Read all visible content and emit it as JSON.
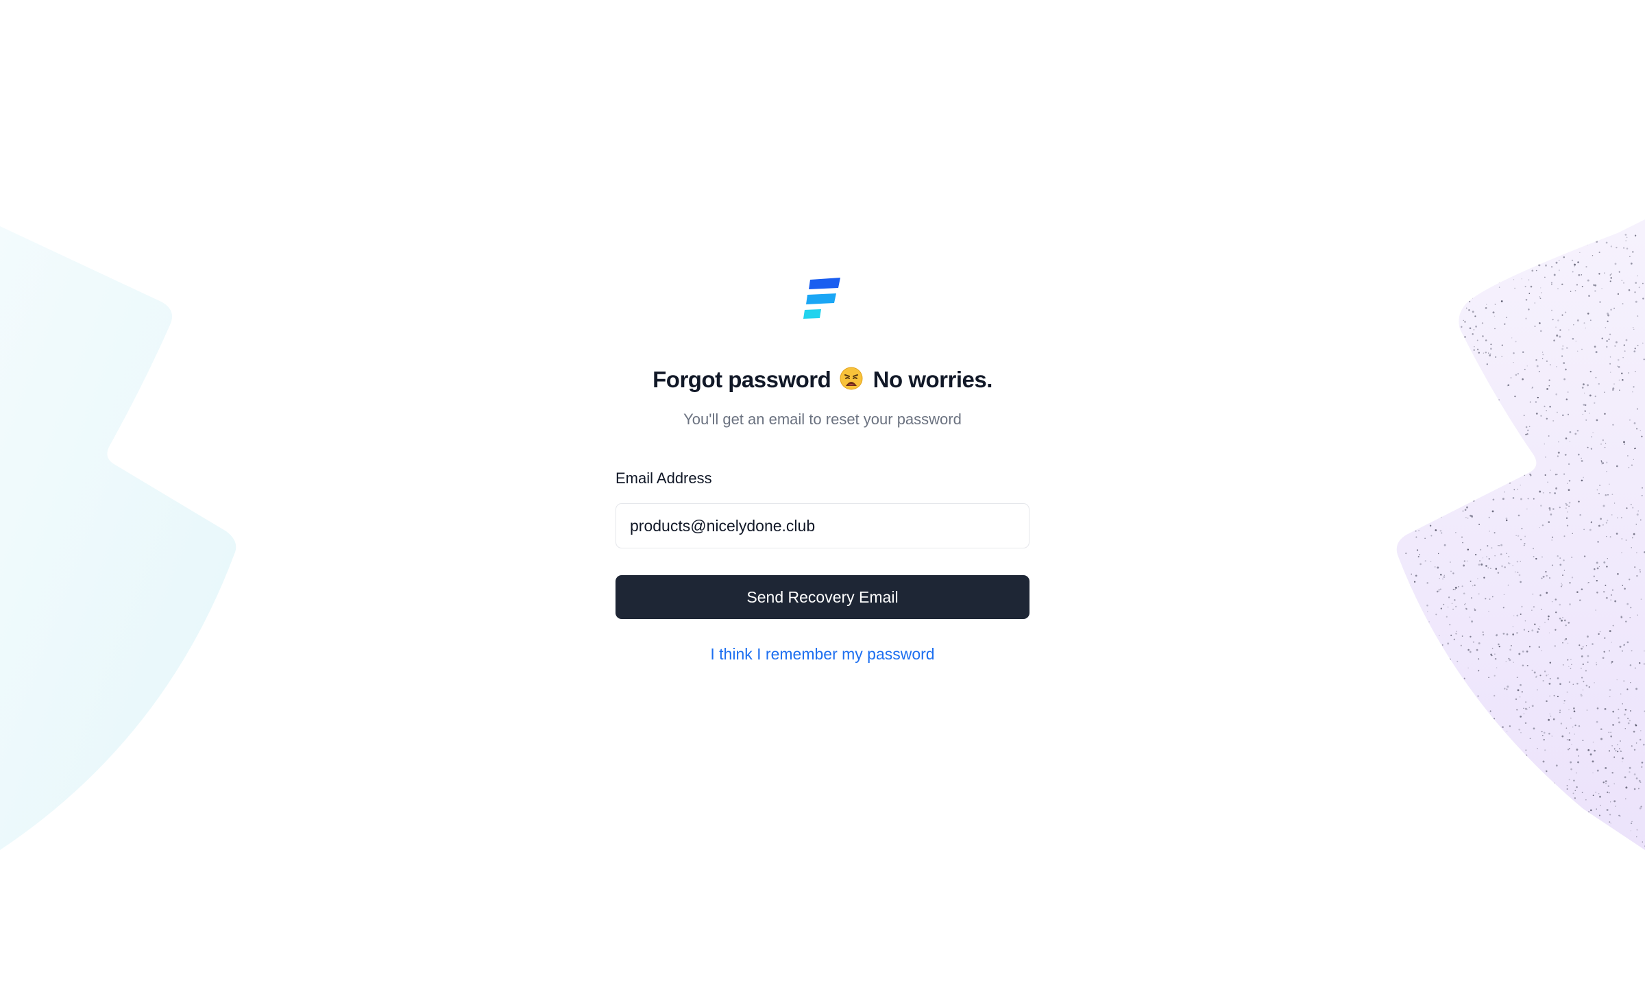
{
  "auth": {
    "title_before_emoji": "Forgot password",
    "title_emoji": "weary-face",
    "title_after_emoji": "No worries.",
    "subtitle": "You'll get an email to reset your password",
    "email_label": "Email Address",
    "email_value": "products@nicelydone.club",
    "submit_label": "Send Recovery Email",
    "remember_link": "I think I remember my password"
  },
  "colors": {
    "primary_button": "#1e2635",
    "link": "#1d6ff0",
    "logo_bar_1": "#1a5ef0",
    "logo_bar_2": "#1aa6f5",
    "logo_bar_3": "#22d3ee",
    "bg_left_tint": "#e8f8fb",
    "bg_right_tint": "#efe8fb"
  },
  "icons": {
    "logo": "brand-logo-icon",
    "emoji": "weary-face-icon"
  }
}
